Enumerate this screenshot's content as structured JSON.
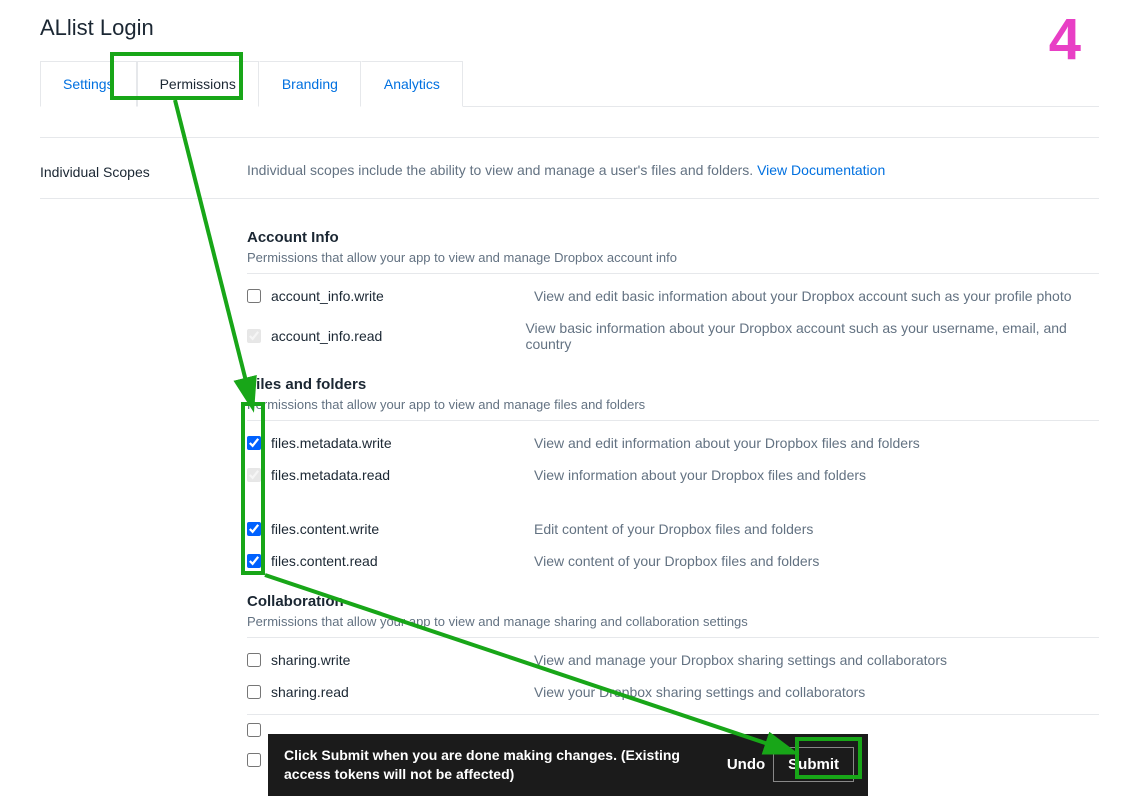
{
  "page": {
    "title": "ALlist Login"
  },
  "tabs": {
    "settings": "Settings",
    "permissions": "Permissions",
    "branding": "Branding",
    "analytics": "Analytics"
  },
  "scopes_intro": {
    "label": "Individual Scopes",
    "text": "Individual scopes include the ability to view and manage a user's files and folders. ",
    "link": "View Documentation"
  },
  "groups": {
    "account": {
      "title": "Account Info",
      "desc": "Permissions that allow your app to view and manage Dropbox account info",
      "items": [
        {
          "name": "account_info.write",
          "desc": "View and edit basic information about your Dropbox account such as your profile photo",
          "checked": false,
          "disabled": false
        },
        {
          "name": "account_info.read",
          "desc": "View basic information about your Dropbox account such as your username, email, and country",
          "checked": true,
          "disabled": true
        }
      ]
    },
    "files": {
      "title": "Files and folders",
      "desc": "Permissions that allow your app to view and manage files and folders",
      "items": [
        {
          "name": "files.metadata.write",
          "desc": "View and edit information about your Dropbox files and folders",
          "checked": true,
          "disabled": false
        },
        {
          "name": "files.metadata.read",
          "desc": "View information about your Dropbox files and folders",
          "checked": true,
          "disabled": true
        },
        {
          "name": "files.content.write",
          "desc": "Edit content of your Dropbox files and folders",
          "checked": true,
          "disabled": false
        },
        {
          "name": "files.content.read",
          "desc": "View content of your Dropbox files and folders",
          "checked": true,
          "disabled": false
        }
      ]
    },
    "collab": {
      "title": "Collaboration",
      "desc": "Permissions that allow your app to view and manage sharing and collaboration settings",
      "items": [
        {
          "name": "sharing.write",
          "desc": "View and manage your Dropbox sharing settings and collaborators",
          "checked": false,
          "disabled": false
        },
        {
          "name": "sharing.read",
          "desc": "View your Dropbox sharing settings and collaborators",
          "checked": false,
          "disabled": false
        }
      ]
    }
  },
  "submit_bar": {
    "message": "Click Submit when you are done making changes. (Existing access tokens will not be affected)",
    "undo": "Undo",
    "submit": "Submit"
  },
  "annotation": {
    "step": "4"
  }
}
